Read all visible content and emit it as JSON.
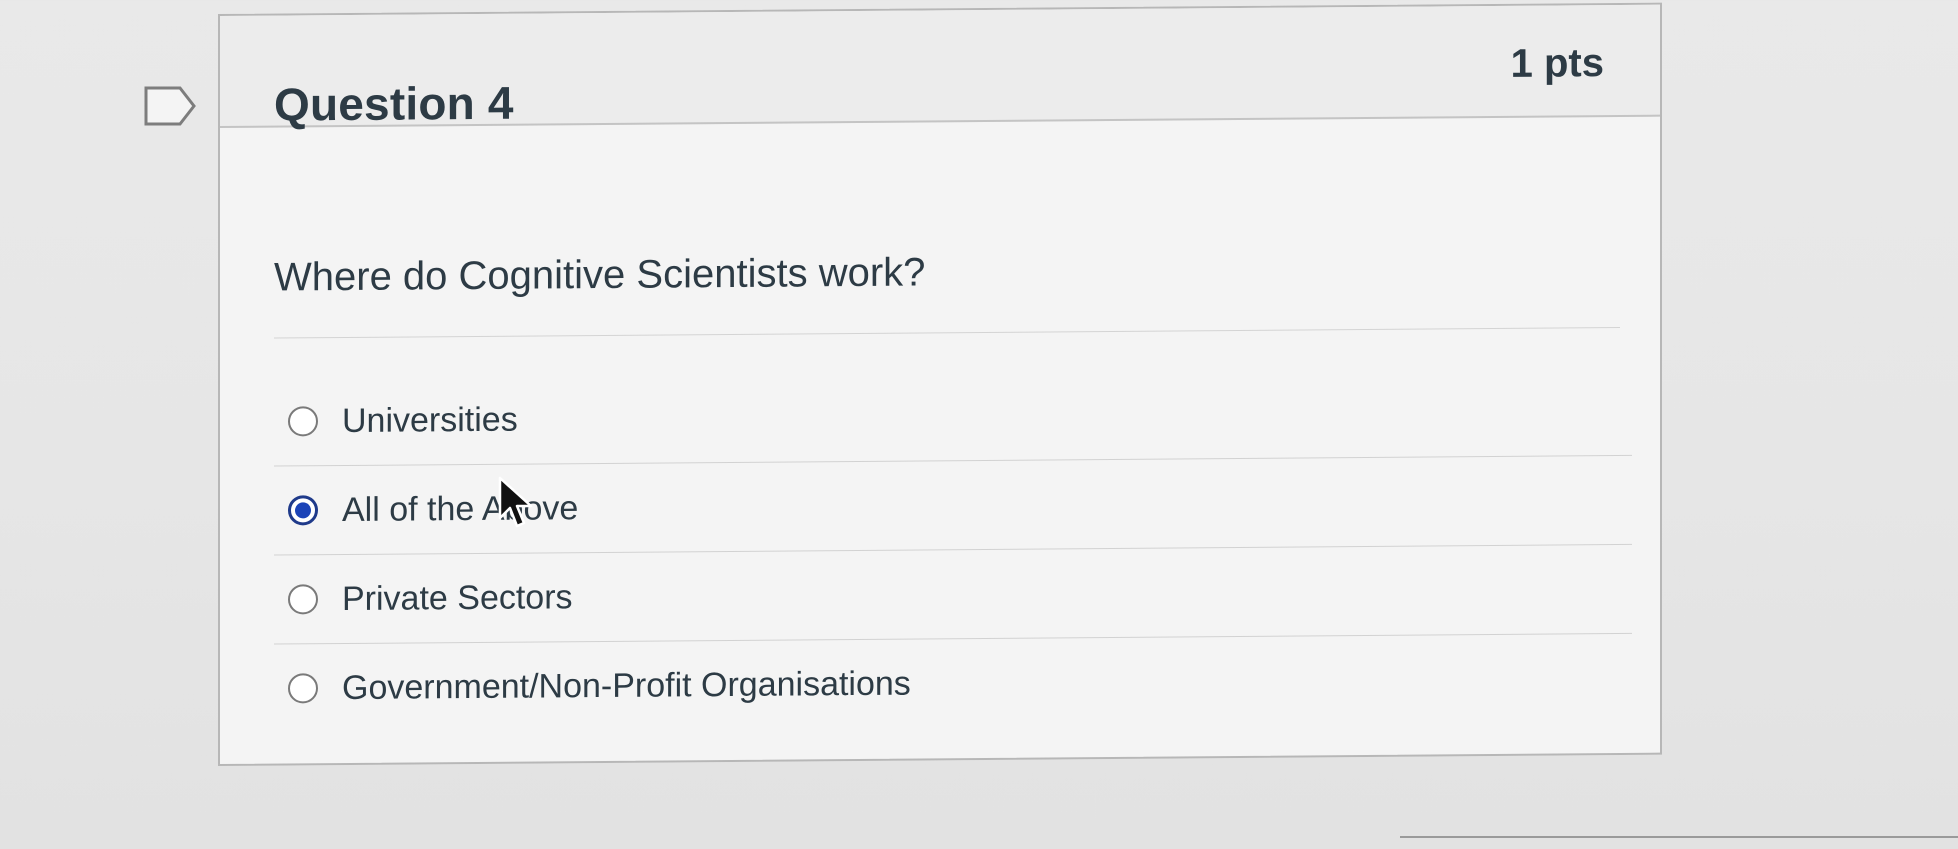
{
  "question": {
    "title": "Question 4",
    "points": "1 pts",
    "text": "Where do Cognitive Scientists work?",
    "answers": [
      {
        "label": "Universities",
        "selected": false
      },
      {
        "label": "All of the Above",
        "selected": true
      },
      {
        "label": "Private Sectors",
        "selected": false
      },
      {
        "label": "Government/Non-Profit Organisations",
        "selected": false
      }
    ]
  },
  "icons": {
    "flag": "bookmark-flag-icon",
    "cursor": "mouse-pointer-icon"
  },
  "colors": {
    "selected_radio": "#1c44b8",
    "text": "#2d3b45",
    "header_bg": "#ececec"
  }
}
